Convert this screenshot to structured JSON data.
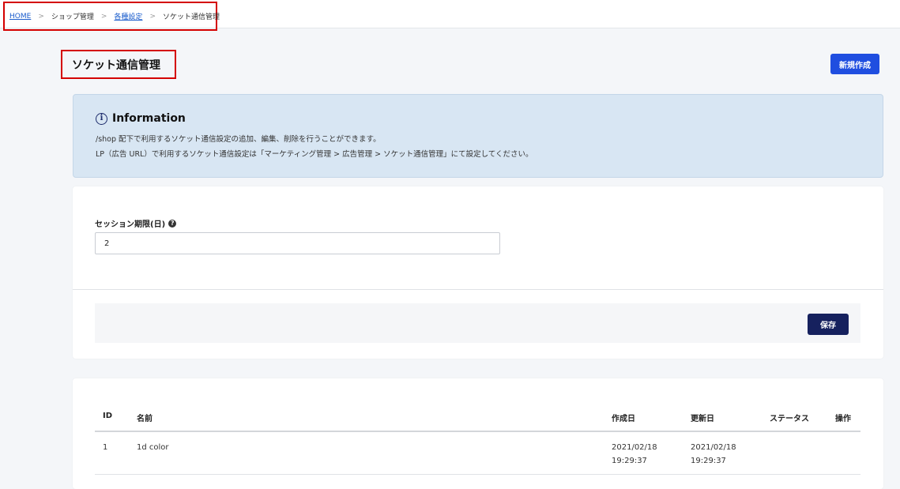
{
  "breadcrumb": {
    "home": "HOME",
    "sep1": ">",
    "shop_management": "ショップ管理",
    "sep2": ">",
    "settings": "各種設定",
    "sep3": ">",
    "current": "ソケット通信管理"
  },
  "header": {
    "title": "ソケット通信管理",
    "new_button": "新規作成"
  },
  "info": {
    "icon": "info-icon",
    "icon_glyph": "i",
    "title": "Information",
    "line1": "/shop 配下で利用するソケット通信設定の追加、編集、削除を行うことができます。",
    "line2": "LP（広告 URL）で利用するソケット通信設定は「マーケティング管理 > 広告管理 > ソケット通信管理」にて設定してください。"
  },
  "settings_form": {
    "session_label": "セッション期限(日)",
    "help_icon": "question-circle-icon",
    "help_glyph": "?",
    "session_value": "2",
    "save_button": "保存"
  },
  "table": {
    "columns": [
      "ID",
      "名前",
      "作成日",
      "更新日",
      "ステータス",
      "操作"
    ],
    "rows": [
      {
        "id": "1",
        "name": "1d color",
        "created_date": "2021/02/18",
        "created_time": "19:29:37",
        "updated_date": "2021/02/18",
        "updated_time": "19:29:37",
        "status": "",
        "actions": ""
      }
    ]
  },
  "colors": {
    "primary_button": "#1f4ee0",
    "save_button": "#16215e",
    "info_bg": "#d8e6f3",
    "highlight_border": "#d40000",
    "link": "#1a5ccc"
  }
}
